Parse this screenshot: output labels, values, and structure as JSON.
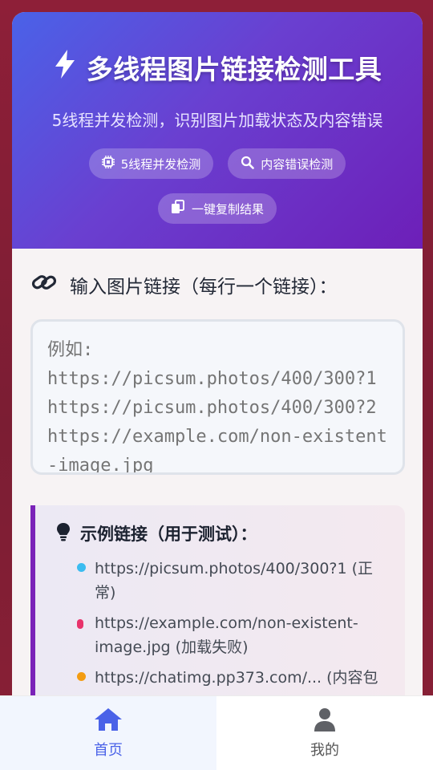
{
  "header": {
    "title": "多线程图片链接检测工具",
    "subtitle": "5线程并发检测，识别图片加载状态及内容错误",
    "badges": [
      {
        "label": "5线程并发检测",
        "icon": "cpu-icon"
      },
      {
        "label": "内容错误检测",
        "icon": "search-icon"
      },
      {
        "label": "一键复制结果",
        "icon": "copy-icon"
      }
    ]
  },
  "input": {
    "label": "输入图片链接（每行一个链接）：",
    "placeholder": "例如:\nhttps://picsum.photos/400/300?1\nhttps://picsum.photos/400/300?2\nhttps://example.com/non-existent-image.jpg"
  },
  "examples": {
    "title": "示例链接（用于测试）：",
    "items": [
      {
        "text": "https://picsum.photos/400/300?1 (正常)",
        "color": "#3bbcf0"
      },
      {
        "text": "https://example.com/non-existent-image.jpg (加载失败)",
        "color": "#e8336b"
      },
      {
        "text": "https://chatimg.pp373.com/... (内容包",
        "color": "#f39c12"
      }
    ]
  },
  "tabbar": {
    "home": "首页",
    "mine": "我的"
  },
  "colors": {
    "accent": "#4a62e8",
    "header_gradient_end": "#6d1fb8"
  }
}
